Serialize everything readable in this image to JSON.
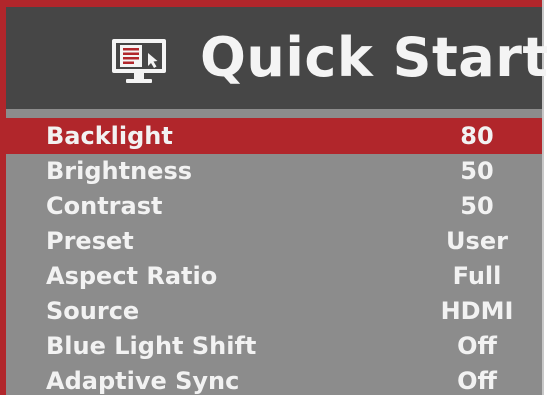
{
  "header": {
    "title": "Quick Start",
    "icon": "monitor-menu-icon"
  },
  "colors": {
    "accent": "#b1262b",
    "header_bg": "#464646",
    "menu_bg": "#8c8c8c",
    "text": "#f2f2f2"
  },
  "menu": {
    "selected_index": 0,
    "items": [
      {
        "label": "Backlight",
        "value": "80"
      },
      {
        "label": "Brightness",
        "value": "50"
      },
      {
        "label": "Contrast",
        "value": "50"
      },
      {
        "label": "Preset",
        "value": "User"
      },
      {
        "label": "Aspect Ratio",
        "value": "Full"
      },
      {
        "label": "Source",
        "value": "HDMI"
      },
      {
        "label": "Blue Light Shift",
        "value": "Off"
      },
      {
        "label": "Adaptive Sync",
        "value": "Off"
      }
    ]
  }
}
